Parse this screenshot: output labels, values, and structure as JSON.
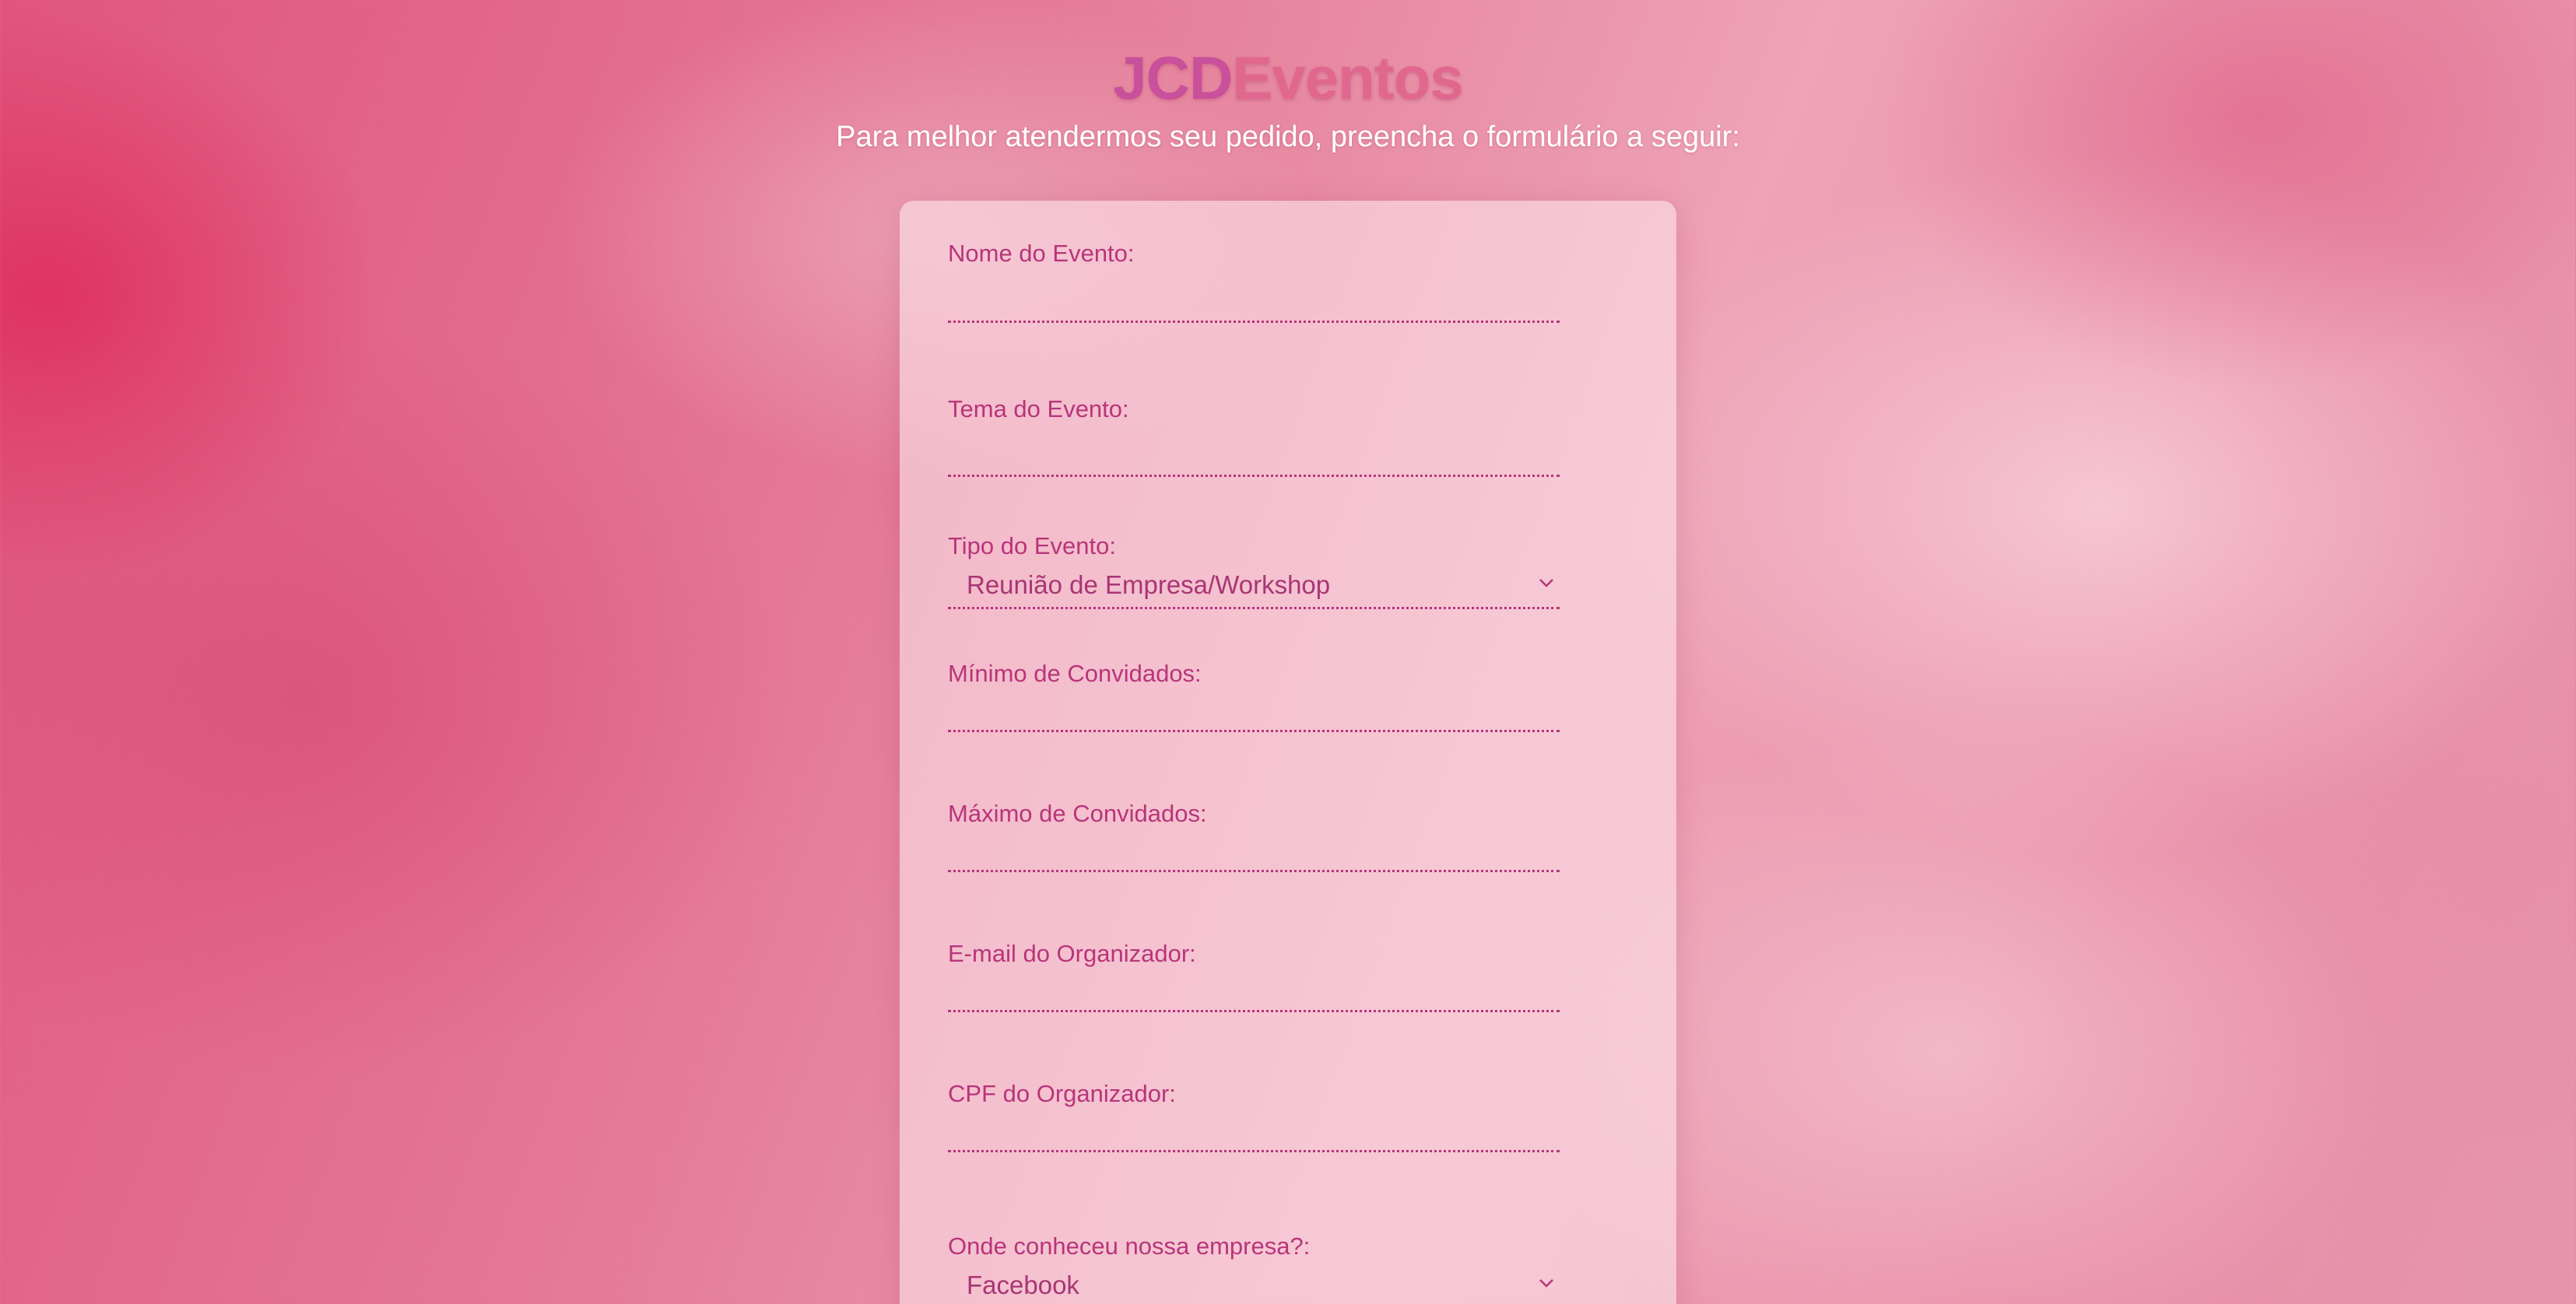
{
  "header": {
    "logo_part_a": "JCD",
    "logo_part_b": "Eventos",
    "subtitle": "Para melhor atendermos seu pedido, preencha o formulário a seguir:"
  },
  "form": {
    "nome_evento": {
      "label": "Nome do Evento:",
      "value": ""
    },
    "tema_evento": {
      "label": "Tema do Evento:",
      "value": ""
    },
    "tipo_evento": {
      "label": "Tipo do Evento:",
      "selected": "Reunião de Empresa/Workshop"
    },
    "minimo_convidados": {
      "label": "Mínimo de Convidados:",
      "value": ""
    },
    "maximo_convidados": {
      "label": "Máximo de Convidados:",
      "value": ""
    },
    "email_organizador": {
      "label": "E-mail do Organizador:",
      "value": ""
    },
    "cpf_organizador": {
      "label": "CPF do Organizador:",
      "value": ""
    },
    "onde_conheceu": {
      "label": "Onde conheceu nossa empresa?:",
      "selected": "Facebook"
    }
  },
  "icons": {
    "select_arrow": "chevron-down-icon"
  },
  "colors": {
    "accent": "#b8357a",
    "logo_a": "#c9509a",
    "logo_b": "#e0688f",
    "card_bg": "#fce1e8"
  }
}
